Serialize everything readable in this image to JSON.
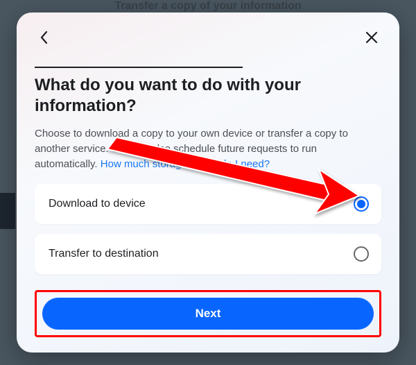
{
  "background": {
    "partial_title": "Transfer a copy of your information"
  },
  "modal": {
    "title": "What do you want to do with your information?",
    "subtitle_part1": "Choose to download a copy to your own device or transfer a copy to another service. You can also schedule future requests to run automatically. ",
    "subtitle_link": "How much storage space do I need?",
    "options": [
      {
        "label": "Download to device",
        "selected": true
      },
      {
        "label": "Transfer to destination",
        "selected": false
      }
    ],
    "next_label": "Next"
  },
  "annotations": {
    "arrow_color": "#ff0000",
    "highlight_color": "#ff0000"
  }
}
